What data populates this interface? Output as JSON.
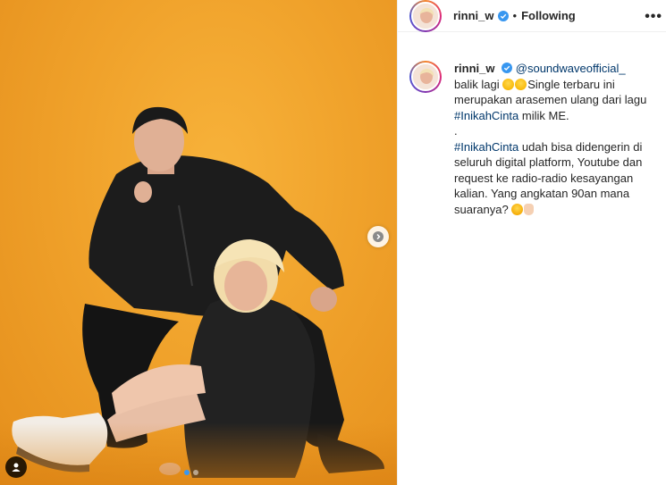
{
  "post": {
    "username": "rinni_w",
    "header_separator": "•",
    "follow_status": "Following",
    "more_label": "•••",
    "carousel": {
      "current_index": 1,
      "total": 2
    }
  },
  "caption": {
    "username": "rinni_w",
    "line1_mention": "@soundwaveofficial_",
    "text_a": " balik lagi ",
    "text_b": "Single terbaru ini merupakan arasemen ulang dari lagu ",
    "hashtag1": "#InikahCinta",
    "text_c": " milik ME.",
    "dot": ".",
    "hashtag2": "#InikahCinta",
    "text_d": " udah bisa didengerin di seluruh digital platform, Youtube dan request ke radio-radio kesayangan kalian. Yang angkatan 90an mana suaranya? "
  },
  "colors": {
    "accent": "#3897f0",
    "link": "#00376b",
    "photo_bg": "#f0a22b"
  }
}
